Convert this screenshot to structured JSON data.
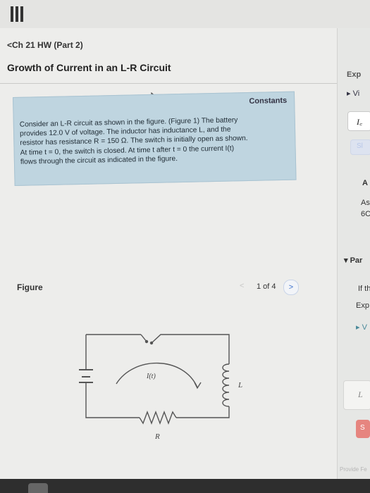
{
  "nav": {
    "back_label": "Ch 21 HW (Part 2)"
  },
  "page": {
    "title": "Growth of Current in an L-R Circuit"
  },
  "constants": {
    "label": "Constants",
    "lines": [
      "Consider an L-R circuit as shown in the figure. (Figure 1) The battery",
      "provides 12.0 V of voltage. The inductor has inductance L, and the",
      "resistor has resistance R = 150 Ω. The switch is initially open as shown.",
      "At time t = 0, the switch is closed. At time t after t = 0 the current I(t)",
      "flows through the circuit as indicated in the figure."
    ]
  },
  "figure": {
    "label": "Figure",
    "counter": "1 of 4",
    "prev_glyph": "<",
    "next_glyph": ">",
    "current_label": "I(t)",
    "inductor_label": "L",
    "resistor_label": "R"
  },
  "right_panel": {
    "items": [
      "Exp",
      "▸ Vi",
      "I꜀",
      "Sl",
      "A",
      "As",
      "6C",
      "▾ Par",
      "If th",
      "Exp",
      "▸ V",
      "L",
      "S",
      "Provide Fe"
    ]
  },
  "colors": {
    "constants_bg": "#bfd5e0",
    "accent_blue": "#3a6fcc",
    "submit_red": "#e6857f",
    "submit_faded": "#b8c7e8"
  }
}
